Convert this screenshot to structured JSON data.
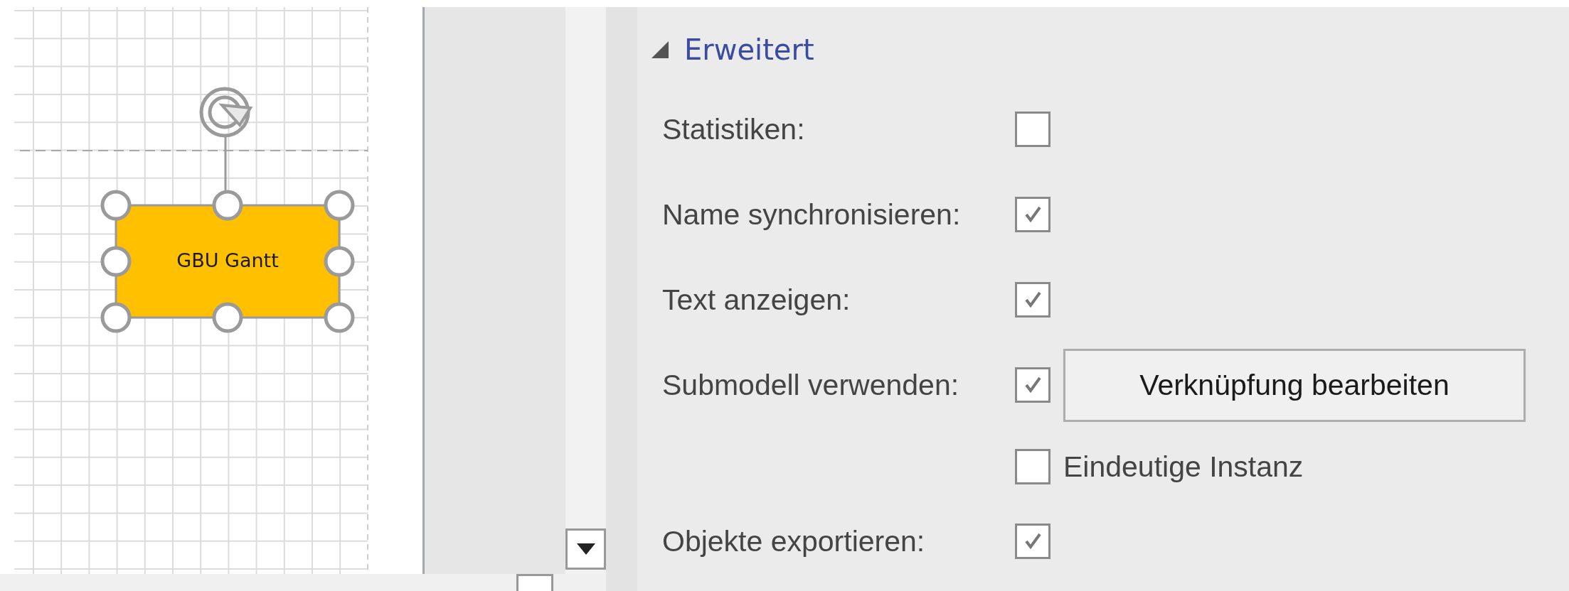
{
  "canvas": {
    "shape": {
      "label": "GBU Gantt",
      "selected": true
    }
  },
  "properties": {
    "section": {
      "title": "Erweitert",
      "expanded": true
    },
    "rows": [
      {
        "kind": "checkbox",
        "label": "Statistiken:",
        "checked": false
      },
      {
        "kind": "checkbox",
        "label": "Name synchronisieren:",
        "checked": true
      },
      {
        "kind": "checkbox",
        "label": "Text anzeigen:",
        "checked": true
      },
      {
        "kind": "checkbox",
        "label": "Submodell verwenden:",
        "checked": true,
        "button": "Verknüpfung bearbeiten"
      },
      {
        "kind": "sub-checkbox",
        "label": "Eindeutige Instanz",
        "checked": false
      },
      {
        "kind": "checkbox",
        "label": "Objekte exportieren:",
        "checked": true
      }
    ]
  }
}
